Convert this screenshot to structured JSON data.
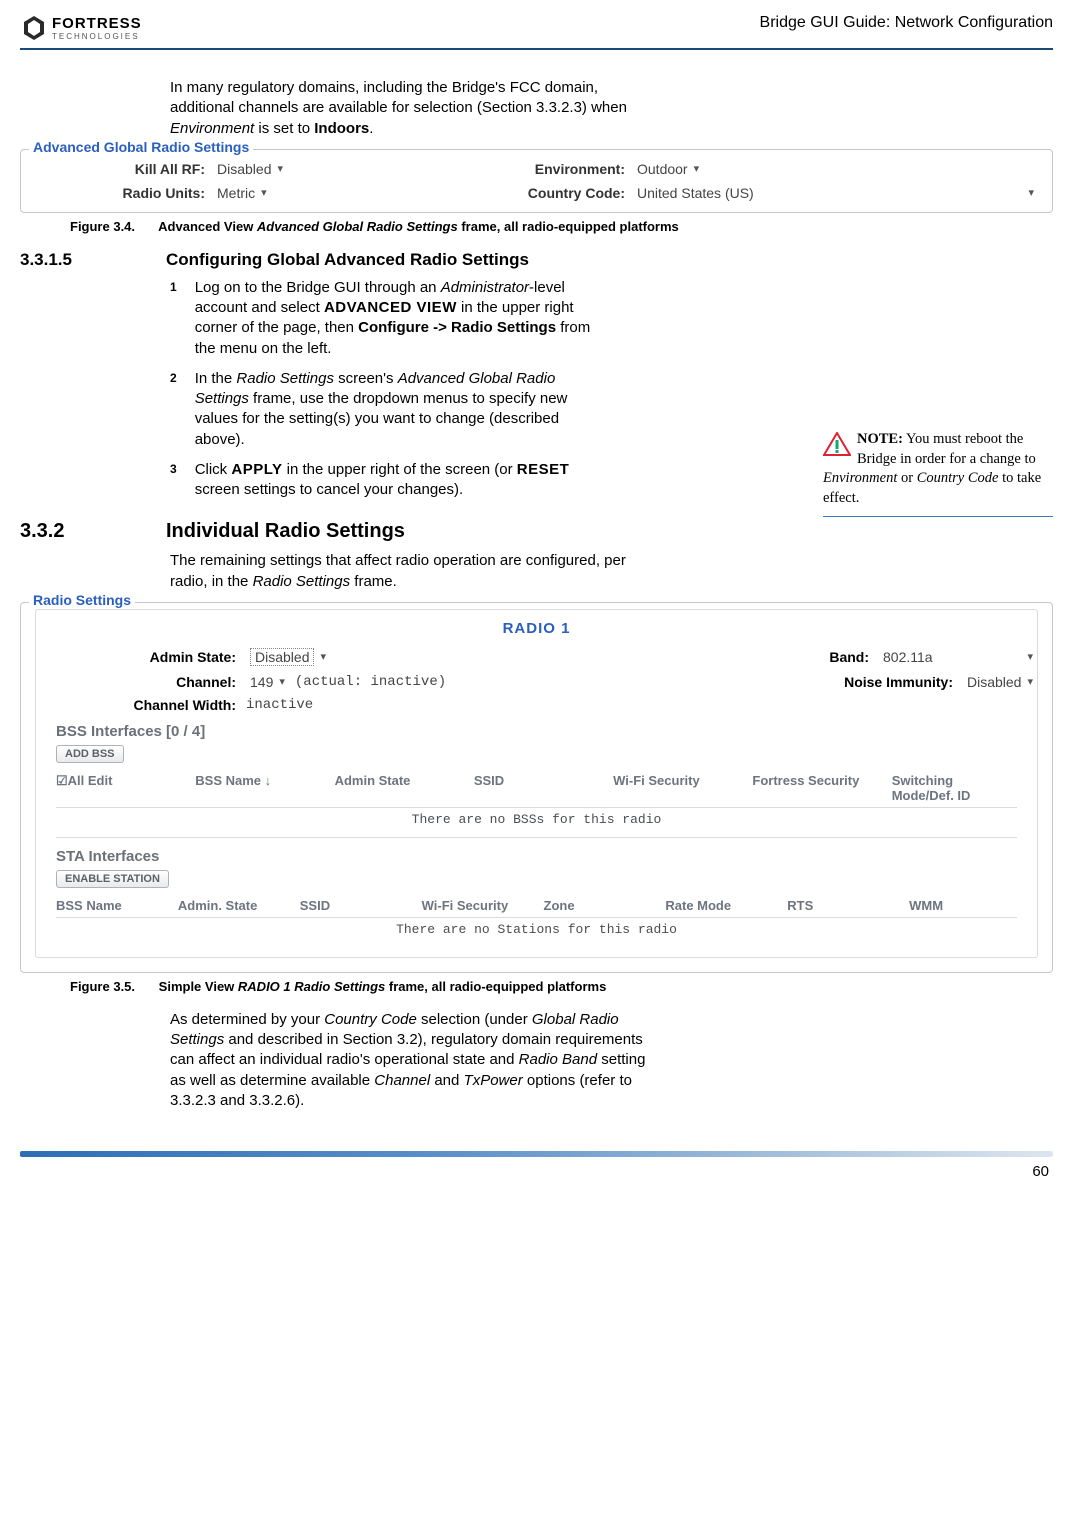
{
  "header": {
    "brand_top": "FORTRESS",
    "brand_sub": "TECHNOLOGIES",
    "doc_title": "Bridge GUI Guide: Network Configuration"
  },
  "intro_para": "In many regulatory domains, including the Bridge's FCC domain, additional channels are available for selection (Section 3.3.2.3) when Environment is set to Indoors.",
  "global_settings": {
    "legend": "Advanced Global Radio Settings",
    "kill_rf_label": "Kill All RF:",
    "kill_rf_value": "Disabled",
    "env_label": "Environment:",
    "env_value": "Outdoor",
    "units_label": "Radio Units:",
    "units_value": "Metric",
    "cc_label": "Country Code:",
    "cc_value": "United States (US)"
  },
  "fig34": {
    "num": "Figure 3.4.",
    "txt_a": "Advanced View ",
    "txt_bi": "Advanced Global Radio Settings",
    "txt_c": " frame, all radio-equipped platforms"
  },
  "sec3315": {
    "num": "3.3.1.5",
    "title": "Configuring Global Advanced Radio Settings"
  },
  "steps": {
    "s1": "Log on to the Bridge GUI through an Administrator-level account and select ADVANCED VIEW in the upper right corner of the page, then Configure -> Radio Settings from the menu on the left.",
    "s2": "In the Radio Settings screen's Advanced Global Radio Settings frame, use the dropdown menus to specify new values for the setting(s) you want to change (described above).",
    "s3": "Click APPLY in the upper right of the screen (or RESET screen settings to cancel your changes)."
  },
  "note": {
    "lead": "NOTE:",
    "body": " You must reboot the Bridge in order for a change to Environment or Country Code to take effect."
  },
  "sec332": {
    "num": "3.3.2",
    "title": "Individual Radio Settings",
    "para": "The remaining settings that affect radio operation are configured, per radio, in the Radio Settings frame."
  },
  "radio_panel": {
    "legend": "Radio Settings",
    "title": "RADIO 1",
    "admin_state_label": "Admin State:",
    "admin_state_value": "Disabled",
    "band_label": "Band:",
    "band_value": "802.11a",
    "channel_label": "Channel:",
    "channel_value": "149",
    "channel_note": "(actual: inactive)",
    "noise_label": "Noise Immunity:",
    "noise_value": "Disabled",
    "cw_label": "Channel Width:",
    "cw_value": "inactive",
    "bss_header": "BSS Interfaces [0 / 4]",
    "add_bss_btn": "ADD BSS",
    "bss_cols": [
      "☑All Edit",
      "BSS Name ↓",
      "Admin State",
      "SSID",
      "Wi-Fi Security",
      "Fortress Security",
      "Switching Mode/Def. ID"
    ],
    "bss_empty": "There are no BSSs for this radio",
    "sta_header": "STA Interfaces",
    "enable_sta_btn": "ENABLE STATION",
    "sta_cols": [
      "BSS Name",
      "Admin. State",
      "SSID",
      "Wi-Fi Security",
      "Zone",
      "Rate Mode",
      "RTS",
      "WMM"
    ],
    "sta_empty": "There are no Stations for this radio"
  },
  "fig35": {
    "num": "Figure 3.5.",
    "txt_a": "Simple View ",
    "txt_bi": "RADIO 1 Radio Settings",
    "txt_c": " frame, all radio-equipped platforms"
  },
  "closing_para": "As determined by your Country Code selection (under Global Radio Settings and described in Section 3.2), regulatory domain requirements can affect an individual radio's operational state and Radio Band setting as well as determine available Channel and TxPower options (refer to 3.3.2.3 and 3.3.2.6).",
  "page_number": "60"
}
